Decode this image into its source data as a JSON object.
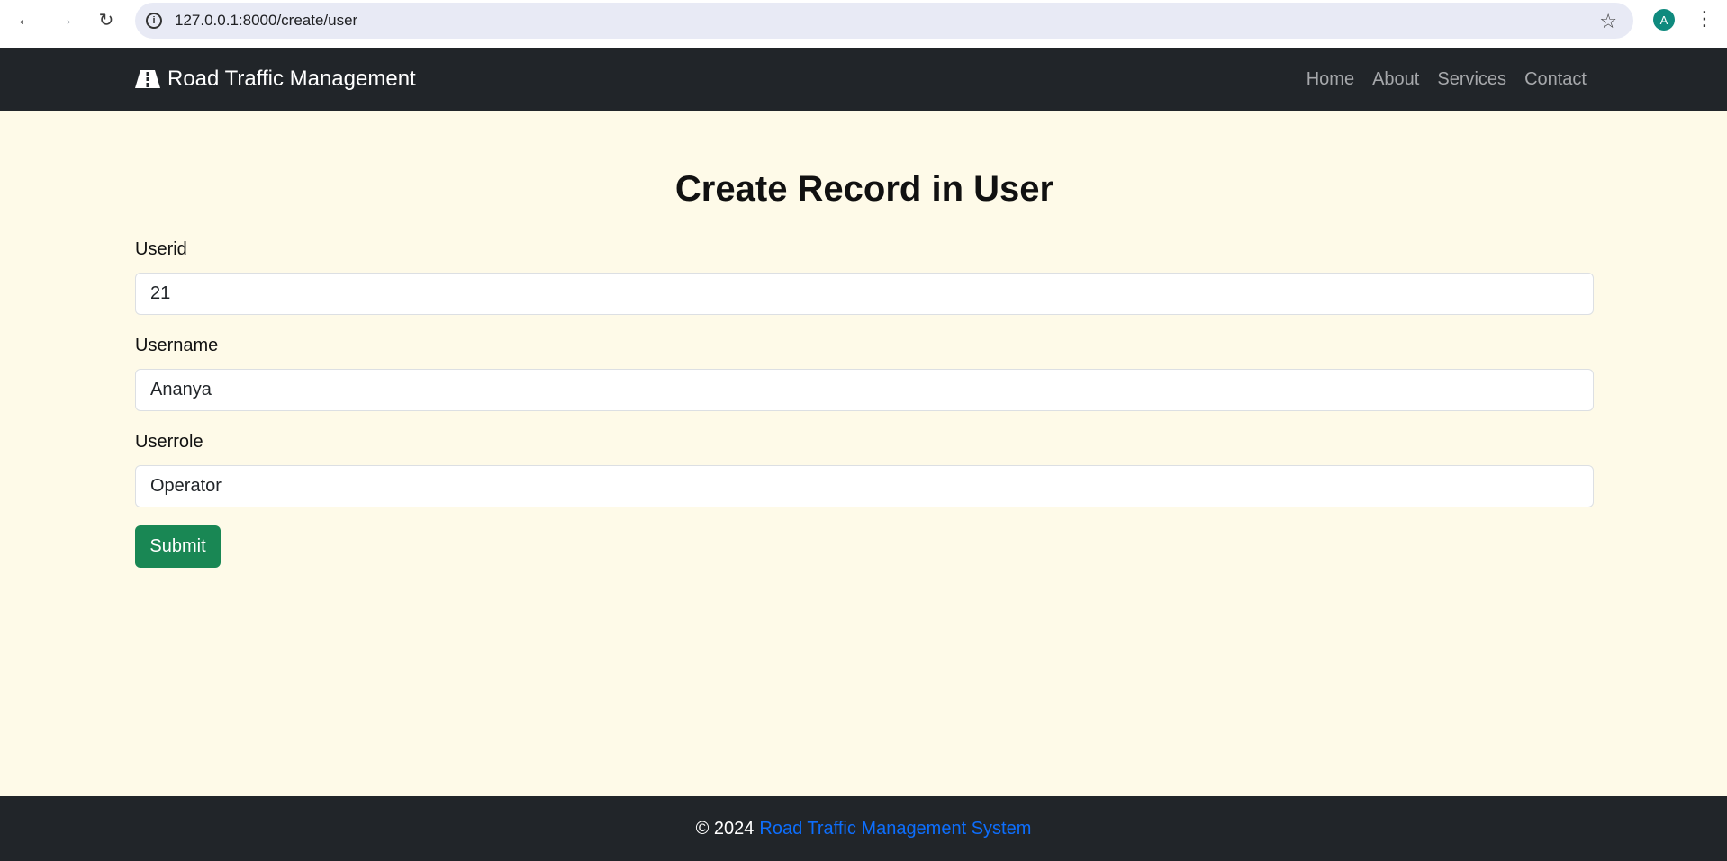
{
  "browser": {
    "url": "127.0.0.1:8000/create/user",
    "avatar_letter": "A",
    "icons": [
      "back-icon",
      "forward-icon",
      "reload-icon",
      "info-icon",
      "star-icon",
      "more-icon"
    ]
  },
  "navbar": {
    "brand": "Road Traffic Management",
    "brand_icon": "road-icon",
    "links": [
      "Home",
      "About",
      "Services",
      "Contact"
    ]
  },
  "form": {
    "title": "Create Record in User",
    "fields": [
      {
        "label": "Userid",
        "value": "21"
      },
      {
        "label": "Username",
        "value": "Ananya"
      },
      {
        "label": "Userrole",
        "value": "Operator"
      }
    ],
    "submit_label": "Submit"
  },
  "footer": {
    "prefix": "© 2024",
    "link": "Road Traffic Management System"
  },
  "colors": {
    "page_bg": "#fefae8",
    "navbar_bg": "#212529",
    "submit_bg": "#198754",
    "footer_link": "#0d6efd"
  }
}
